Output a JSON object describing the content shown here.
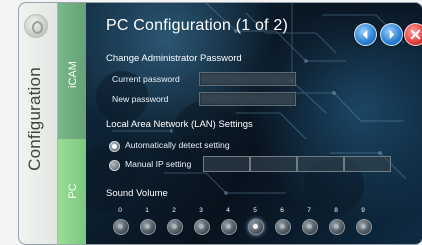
{
  "sidebar": {
    "title": "Configuration",
    "tabs": [
      {
        "label": "iCAM"
      },
      {
        "label": "PC"
      }
    ]
  },
  "header": {
    "title": "PC Configuration (1 of 2)"
  },
  "admin": {
    "heading": "Change Administrator Password",
    "current_password_label": "Current password",
    "new_password_label": "New password"
  },
  "lan": {
    "heading": "Local Area Network (LAN) Settings",
    "auto_label": "Automatically detect setting",
    "manual_label": "Manual IP setting"
  },
  "sound": {
    "heading": "Sound Volume",
    "levels": [
      "0",
      "1",
      "2",
      "3",
      "4",
      "5",
      "6",
      "7",
      "8",
      "9"
    ],
    "selected_index": 5
  },
  "colors": {
    "accent_blue": "#287ed2",
    "close_red": "#e64545",
    "tab_green": "#78c77e"
  },
  "icons": {
    "prev": "chevron-left-icon",
    "next": "chevron-right-icon",
    "close": "close-icon"
  }
}
